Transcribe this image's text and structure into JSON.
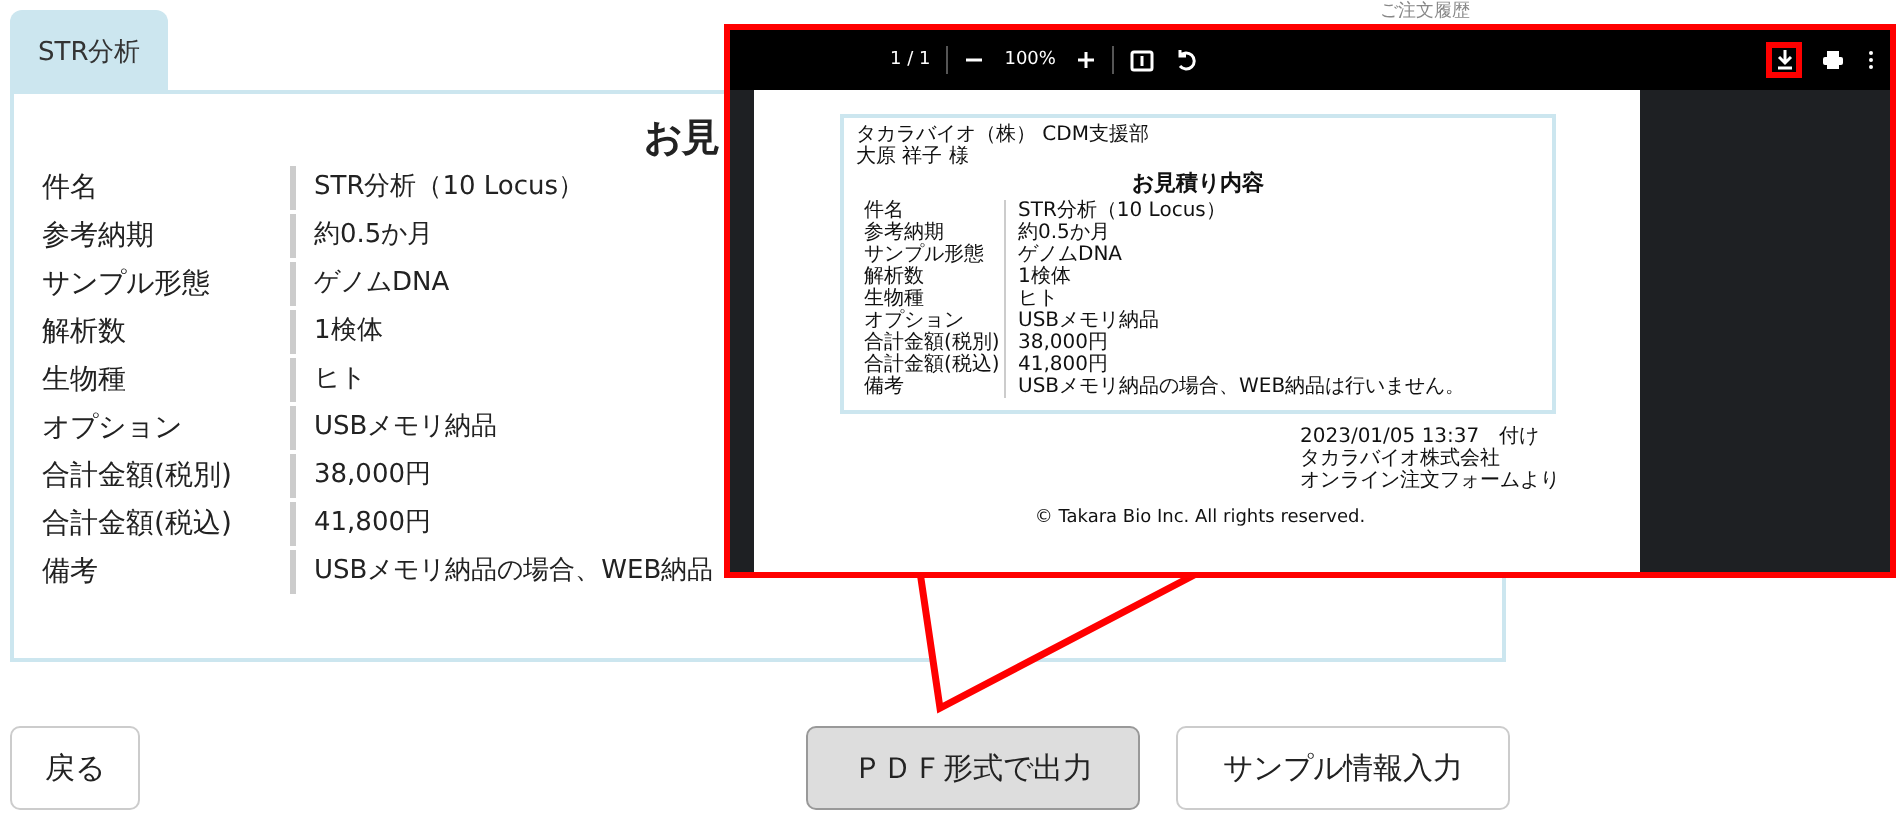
{
  "header_text": "ご注文履歴",
  "tab": {
    "label": "STR分析",
    "selected": true
  },
  "heading": "お見",
  "fields": [
    {
      "label": "件名",
      "value": "STR分析（10 Locus）"
    },
    {
      "label": "参考納期",
      "value": "約0.5か月"
    },
    {
      "label": "サンプル形態",
      "value": "ゲノムDNA"
    },
    {
      "label": "解析数",
      "value": "1検体"
    },
    {
      "label": "生物種",
      "value": "ヒト"
    },
    {
      "label": "オプション",
      "value": "USBメモリ納品"
    },
    {
      "label": "合計金額(税別)",
      "value": "38,000円"
    },
    {
      "label": "合計金額(税込)",
      "value": "41,800円"
    },
    {
      "label": "備考",
      "value": "USBメモリ納品の場合、WEB納品"
    }
  ],
  "buttons": [
    {
      "label": "戻る",
      "kind": "default"
    },
    {
      "label": "ＰＤＦ形式で出力",
      "kind": "pressed"
    },
    {
      "label": "サンプル情報入力",
      "kind": "default"
    }
  ],
  "pdf_viewer": {
    "page": "1 / 1",
    "zoom": "100%",
    "download_highlighted": true,
    "document": {
      "recipient_lines": [
        "タカラバイオ（株） CDM支援部",
        "大原 祥子 様"
      ],
      "title": "お見積り内容",
      "fields": [
        {
          "label": "件名",
          "value": "STR分析（10 Locus）"
        },
        {
          "label": "参考納期",
          "value": "約0.5か月"
        },
        {
          "label": "サンプル形態",
          "value": "ゲノムDNA"
        },
        {
          "label": "解析数",
          "value": "1検体"
        },
        {
          "label": "生物種",
          "value": "ヒト"
        },
        {
          "label": "オプション",
          "value": "USBメモリ納品"
        },
        {
          "label": "合計金額(税別)",
          "value": "38,000円"
        },
        {
          "label": "合計金額(税込)",
          "value": "41,800円"
        },
        {
          "label": "備考",
          "value": "USBメモリ納品の場合、WEB納品は行いません。"
        }
      ],
      "footer_lines": [
        "2023/01/05 13:37　付け",
        "タカラバイオ株式会社",
        "オンライン注文フォームより"
      ],
      "copyright": "© Takara Bio Inc. All rights reserved."
    }
  }
}
